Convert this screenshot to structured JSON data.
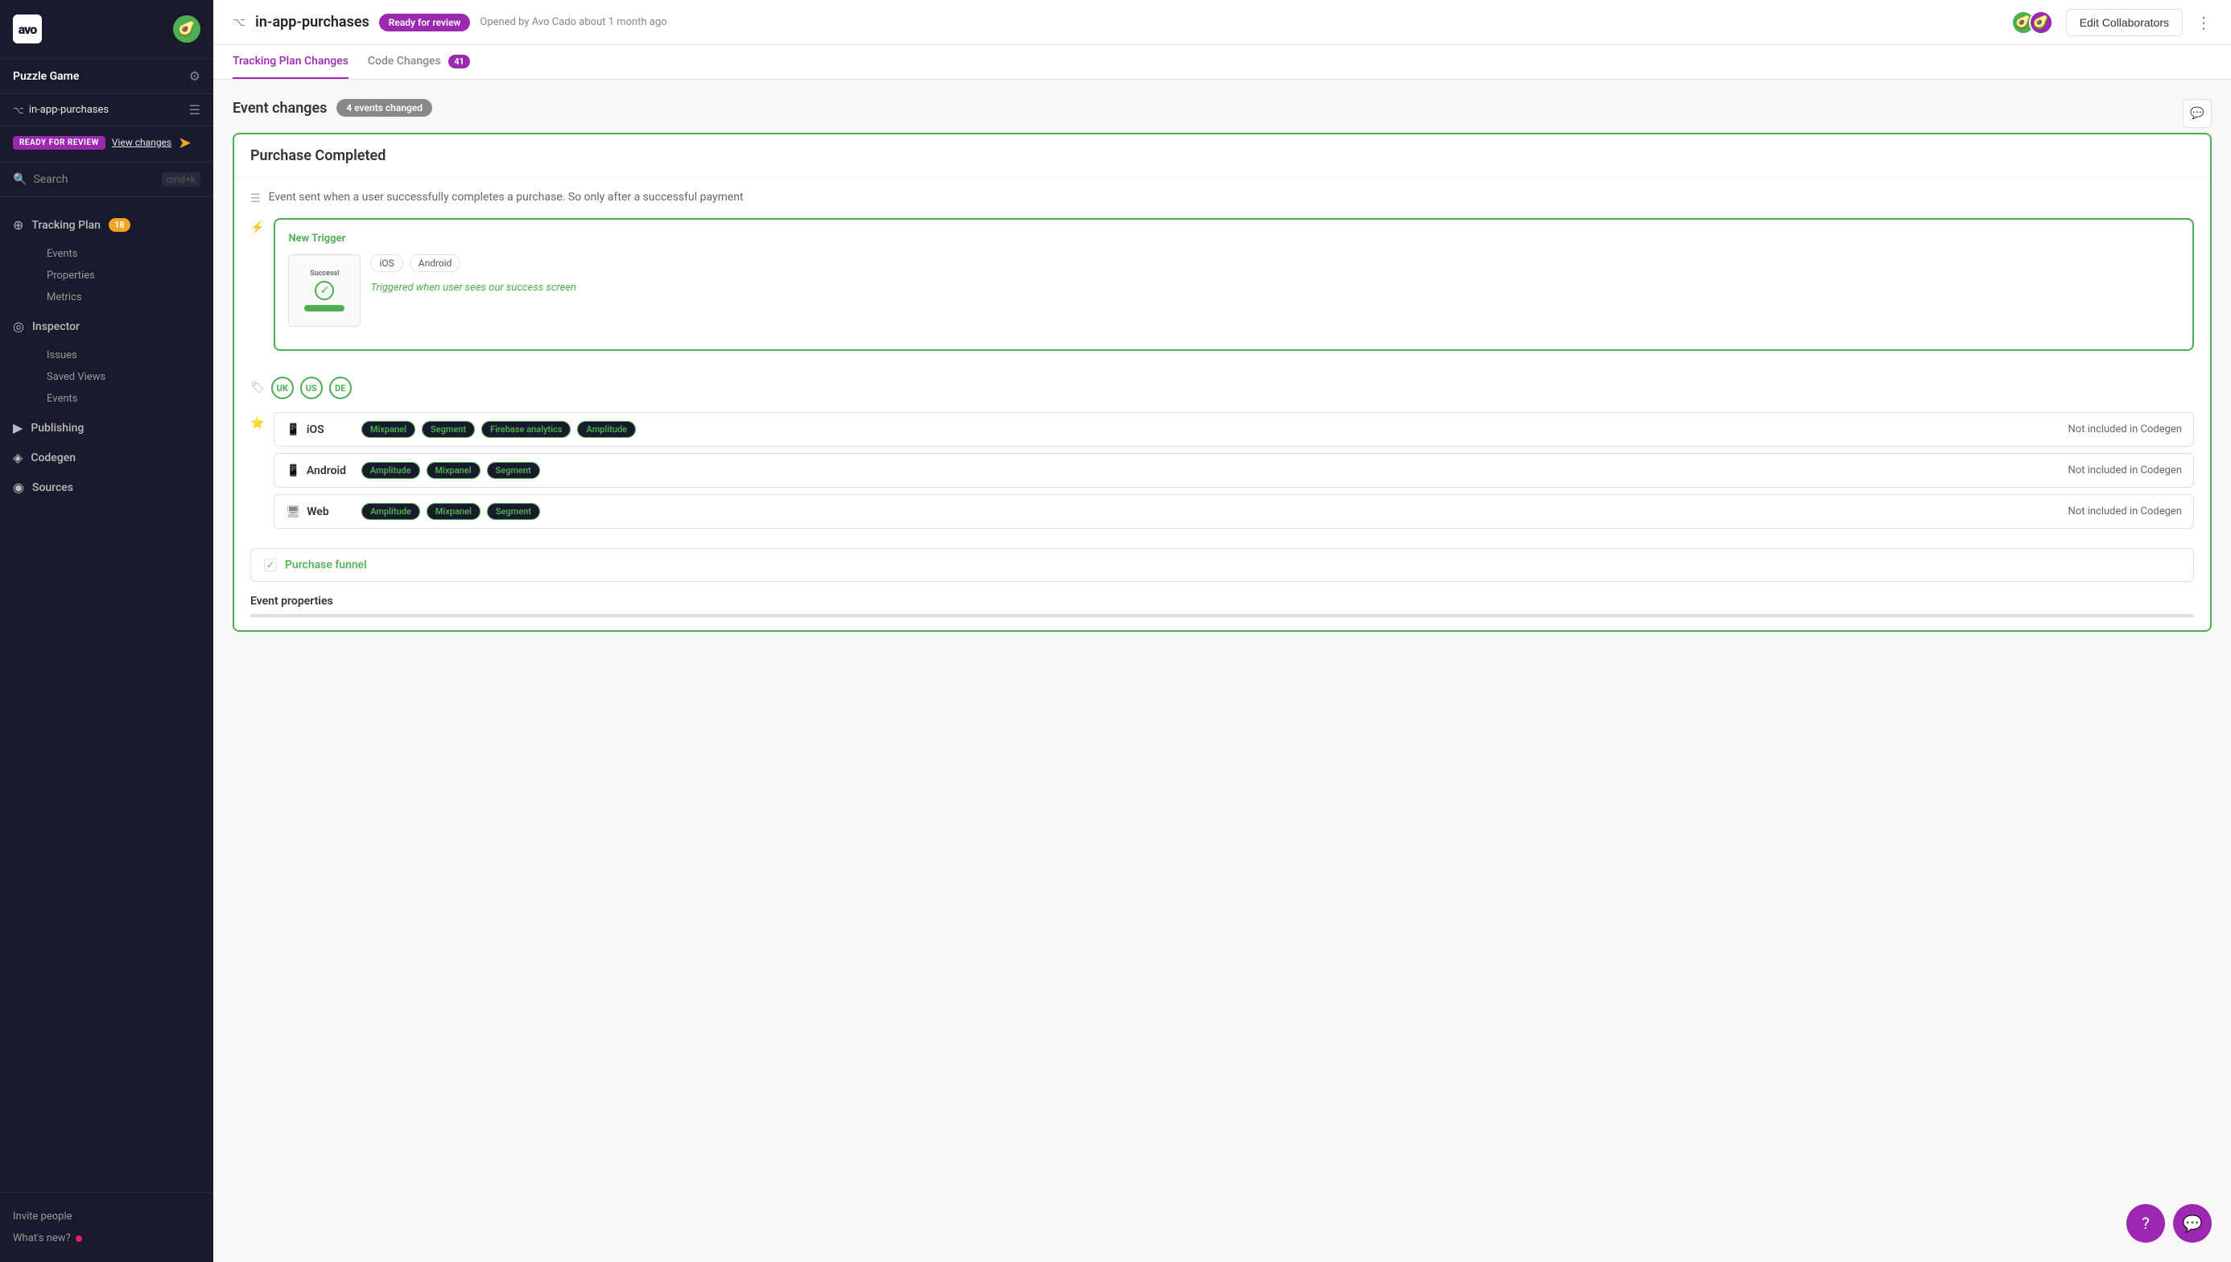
{
  "sidebar": {
    "logo_text": "avo",
    "avatar_emoji": "🥑",
    "workspace": {
      "name": "Puzzle Game",
      "gear_icon": "⚙"
    },
    "branch": {
      "name": "in-app-purchases",
      "branch_icon": "⌥",
      "menu_icon": "☰"
    },
    "review": {
      "badge": "READY FOR REVIEW",
      "view_changes": "View changes"
    },
    "search": {
      "placeholder": "Search",
      "shortcut": "cmd+k"
    },
    "nav": [
      {
        "id": "tracking-plan",
        "icon": "⊕",
        "label": "Tracking Plan",
        "badge": "18",
        "children": [
          "Events",
          "Properties",
          "Metrics"
        ]
      },
      {
        "id": "inspector",
        "icon": "◎",
        "label": "Inspector",
        "children": [
          "Issues",
          "Saved Views",
          "Events"
        ]
      },
      {
        "id": "publishing",
        "icon": "▶",
        "label": "Publishing",
        "children": []
      },
      {
        "id": "codegen",
        "icon": "◈",
        "label": "Codegen",
        "children": []
      },
      {
        "id": "sources",
        "icon": "◉",
        "label": "Sources",
        "children": []
      }
    ],
    "bottom": [
      {
        "label": "Invite people",
        "has_dot": false
      },
      {
        "label": "What's new?",
        "has_dot": true
      }
    ]
  },
  "header": {
    "pr_icon": "⌥",
    "pr_title": "in-app-purchases",
    "status_badge": "Ready for review",
    "meta": "Opened by Avo Cado about 1 month ago",
    "edit_collaborators": "Edit Collaborators",
    "more_icon": "⋮"
  },
  "tabs": [
    {
      "label": "Tracking Plan Changes",
      "active": true,
      "badge": null
    },
    {
      "label": "Code Changes",
      "active": false,
      "badge": "41"
    }
  ],
  "main": {
    "section_title": "Event changes",
    "events_badge": "4 events changed",
    "event": {
      "name": "Purchase Completed",
      "description": "Event sent when a user successfully completes a purchase. So only after a successful payment",
      "trigger": {
        "label": "New Trigger",
        "image_title": "Success!",
        "platforms": [
          "iOS",
          "Android"
        ],
        "trigger_desc": "Triggered when user sees our success screen"
      },
      "tags": [
        "UK",
        "US",
        "DE"
      ],
      "sources": [
        {
          "platform": "iOS",
          "tools": [
            "Mixpanel",
            "Segment",
            "Firebase analytics",
            "Amplitude"
          ],
          "codegen": "Not included in Codegen"
        },
        {
          "platform": "Android",
          "tools": [
            "Amplitude",
            "Mixpanel",
            "Segment"
          ],
          "codegen": "Not included in Codegen"
        },
        {
          "platform": "Web",
          "tools": [
            "Amplitude",
            "Mixpanel",
            "Segment"
          ],
          "codegen": "Not included in Codegen"
        }
      ],
      "funnel": "Purchase funnel",
      "event_properties_label": "Event properties"
    }
  },
  "fabs": {
    "help_icon": "?",
    "chat_icon": "💬"
  }
}
